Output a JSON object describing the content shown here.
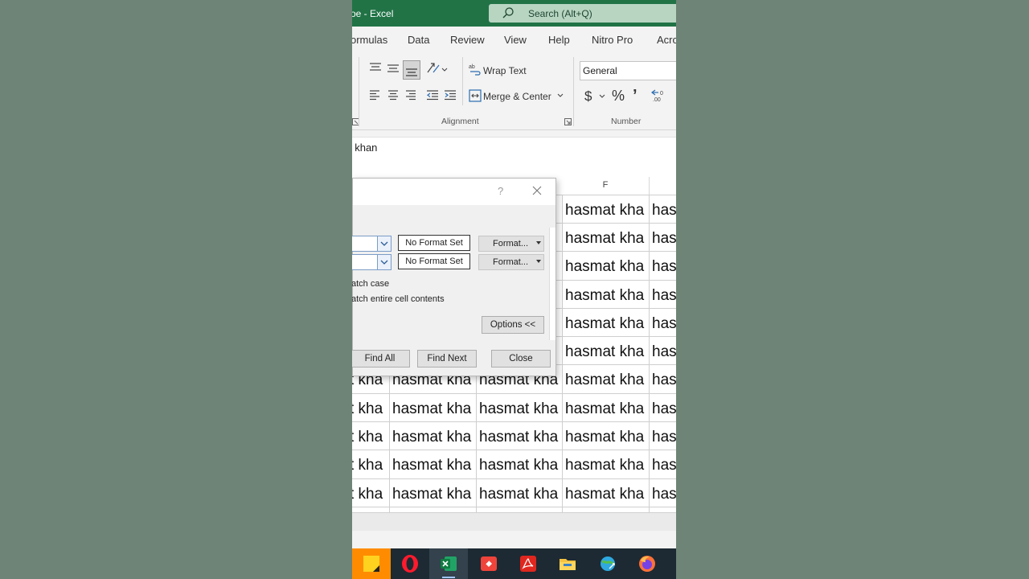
{
  "window": {
    "title": "oe  -  Excel"
  },
  "search": {
    "label": "Search (Alt+Q)"
  },
  "tabs": [
    "ormulas",
    "Data",
    "Review",
    "View",
    "Help",
    "Nitro Pro",
    "Acro"
  ],
  "ribbon": {
    "wrap_text": "Wrap Text",
    "merge_center": "Merge & Center",
    "alignment_label": "Alignment",
    "number_label": "Number",
    "number_format": "General",
    "currency": "$",
    "percent": "%",
    "comma": "’"
  },
  "formula_bar": {
    "text": "t khan"
  },
  "columns": {
    "f": "F"
  },
  "cell_text": "hasmat kha",
  "cell_text_edge_a": "a",
  "cell_text_edge_has": "has",
  "cell_text_left": "t kha",
  "dialog": {
    "help": "?",
    "no_format_1": "No Format Set",
    "no_format_2": "No Format Set",
    "format_1": "Format...",
    "format_2": "Format...",
    "match_case": "atch case",
    "match_entire": "atch entire cell contents",
    "options": "Options <<",
    "find_all": "Find All",
    "find_next": "Find Next",
    "close": "Close"
  },
  "colors": {
    "excel_green": "#217346",
    "taskbar": "#1d2a33",
    "background": "#6e8476"
  }
}
